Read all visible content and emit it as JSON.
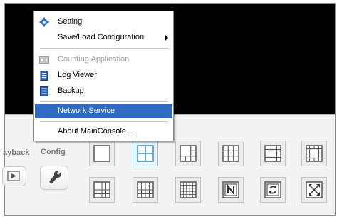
{
  "window": {
    "title": ""
  },
  "side_tools": {
    "playback_label": "ayback",
    "config_label": "Config",
    "play_icon": "play-icon",
    "config_icon": "wrench-icon"
  },
  "menu": {
    "items": [
      {
        "label": "Setting",
        "icon": "gear-icon",
        "enabled": true
      },
      {
        "label": "Save/Load Configuration",
        "icon": "",
        "enabled": true,
        "submenu": true
      },
      {
        "label": "Counting Application",
        "icon": "counter-icon",
        "enabled": false
      },
      {
        "label": "Log Viewer",
        "icon": "log-icon",
        "enabled": true
      },
      {
        "label": "Backup",
        "icon": "backup-icon",
        "enabled": true
      },
      {
        "label": "Network Service",
        "icon": "",
        "enabled": true,
        "highlighted": true
      },
      {
        "label": "About MainConsole...",
        "icon": "",
        "enabled": true
      }
    ]
  },
  "layout_buttons": {
    "row1": [
      "layout-1-icon",
      "layout-4-icon",
      "layout-6-icon",
      "layout-9-icon",
      "layout-8-icon",
      "layout-13-icon"
    ],
    "row2": [
      "layout-16a-icon",
      "layout-16b-icon",
      "layout-25-icon",
      "n-icon",
      "sequence-icon",
      "fullscreen-icon"
    ],
    "selected_index": 1,
    "colors": {
      "icon_stroke": "#555555",
      "selected_border": "#7fc4ea"
    }
  },
  "colors": {
    "highlight": "#316ac5",
    "video_bg": "#000000",
    "panel_bg": "#f3f3f3"
  }
}
